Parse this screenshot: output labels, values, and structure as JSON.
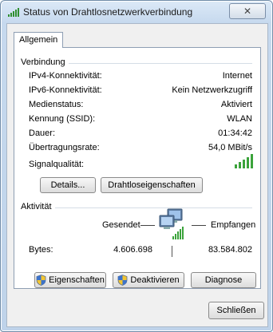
{
  "window": {
    "title": "Status von Drahtlosnetzwerkverbindung",
    "close_glyph": "✕"
  },
  "tab": {
    "label": "Allgemein"
  },
  "connection": {
    "group_label": "Verbindung",
    "rows": [
      {
        "label": "IPv4-Konnektivität:",
        "value": "Internet"
      },
      {
        "label": "IPv6-Konnektivität:",
        "value": "Kein Netzwerkzugriff"
      },
      {
        "label": "Medienstatus:",
        "value": "Aktiviert"
      },
      {
        "label": "Kennung (SSID):",
        "value": "WLAN"
      },
      {
        "label": "Dauer:",
        "value": "01:34:42"
      },
      {
        "label": "Übertragungsrate:",
        "value": "54,0 MBit/s"
      }
    ],
    "signal_label": "Signalqualität:",
    "signal_bars_active": 5,
    "signal_bars_total": 5,
    "details_button": "Details...",
    "wireless_props_button": "Drahtloseigenschaften"
  },
  "activity": {
    "group_label": "Aktivität",
    "sent_label": "Gesendet",
    "received_label": "Empfangen",
    "bytes_label": "Bytes:",
    "bytes_sent": "4.606.698",
    "bytes_received": "83.584.802"
  },
  "buttons": {
    "properties": "Eigenschaften",
    "deactivate": "Deaktivieren",
    "diagnose": "Diagnose",
    "close": "Schließen"
  },
  "colors": {
    "signal_green": "#3ba33b",
    "uac_shield": "blue-yellow"
  }
}
